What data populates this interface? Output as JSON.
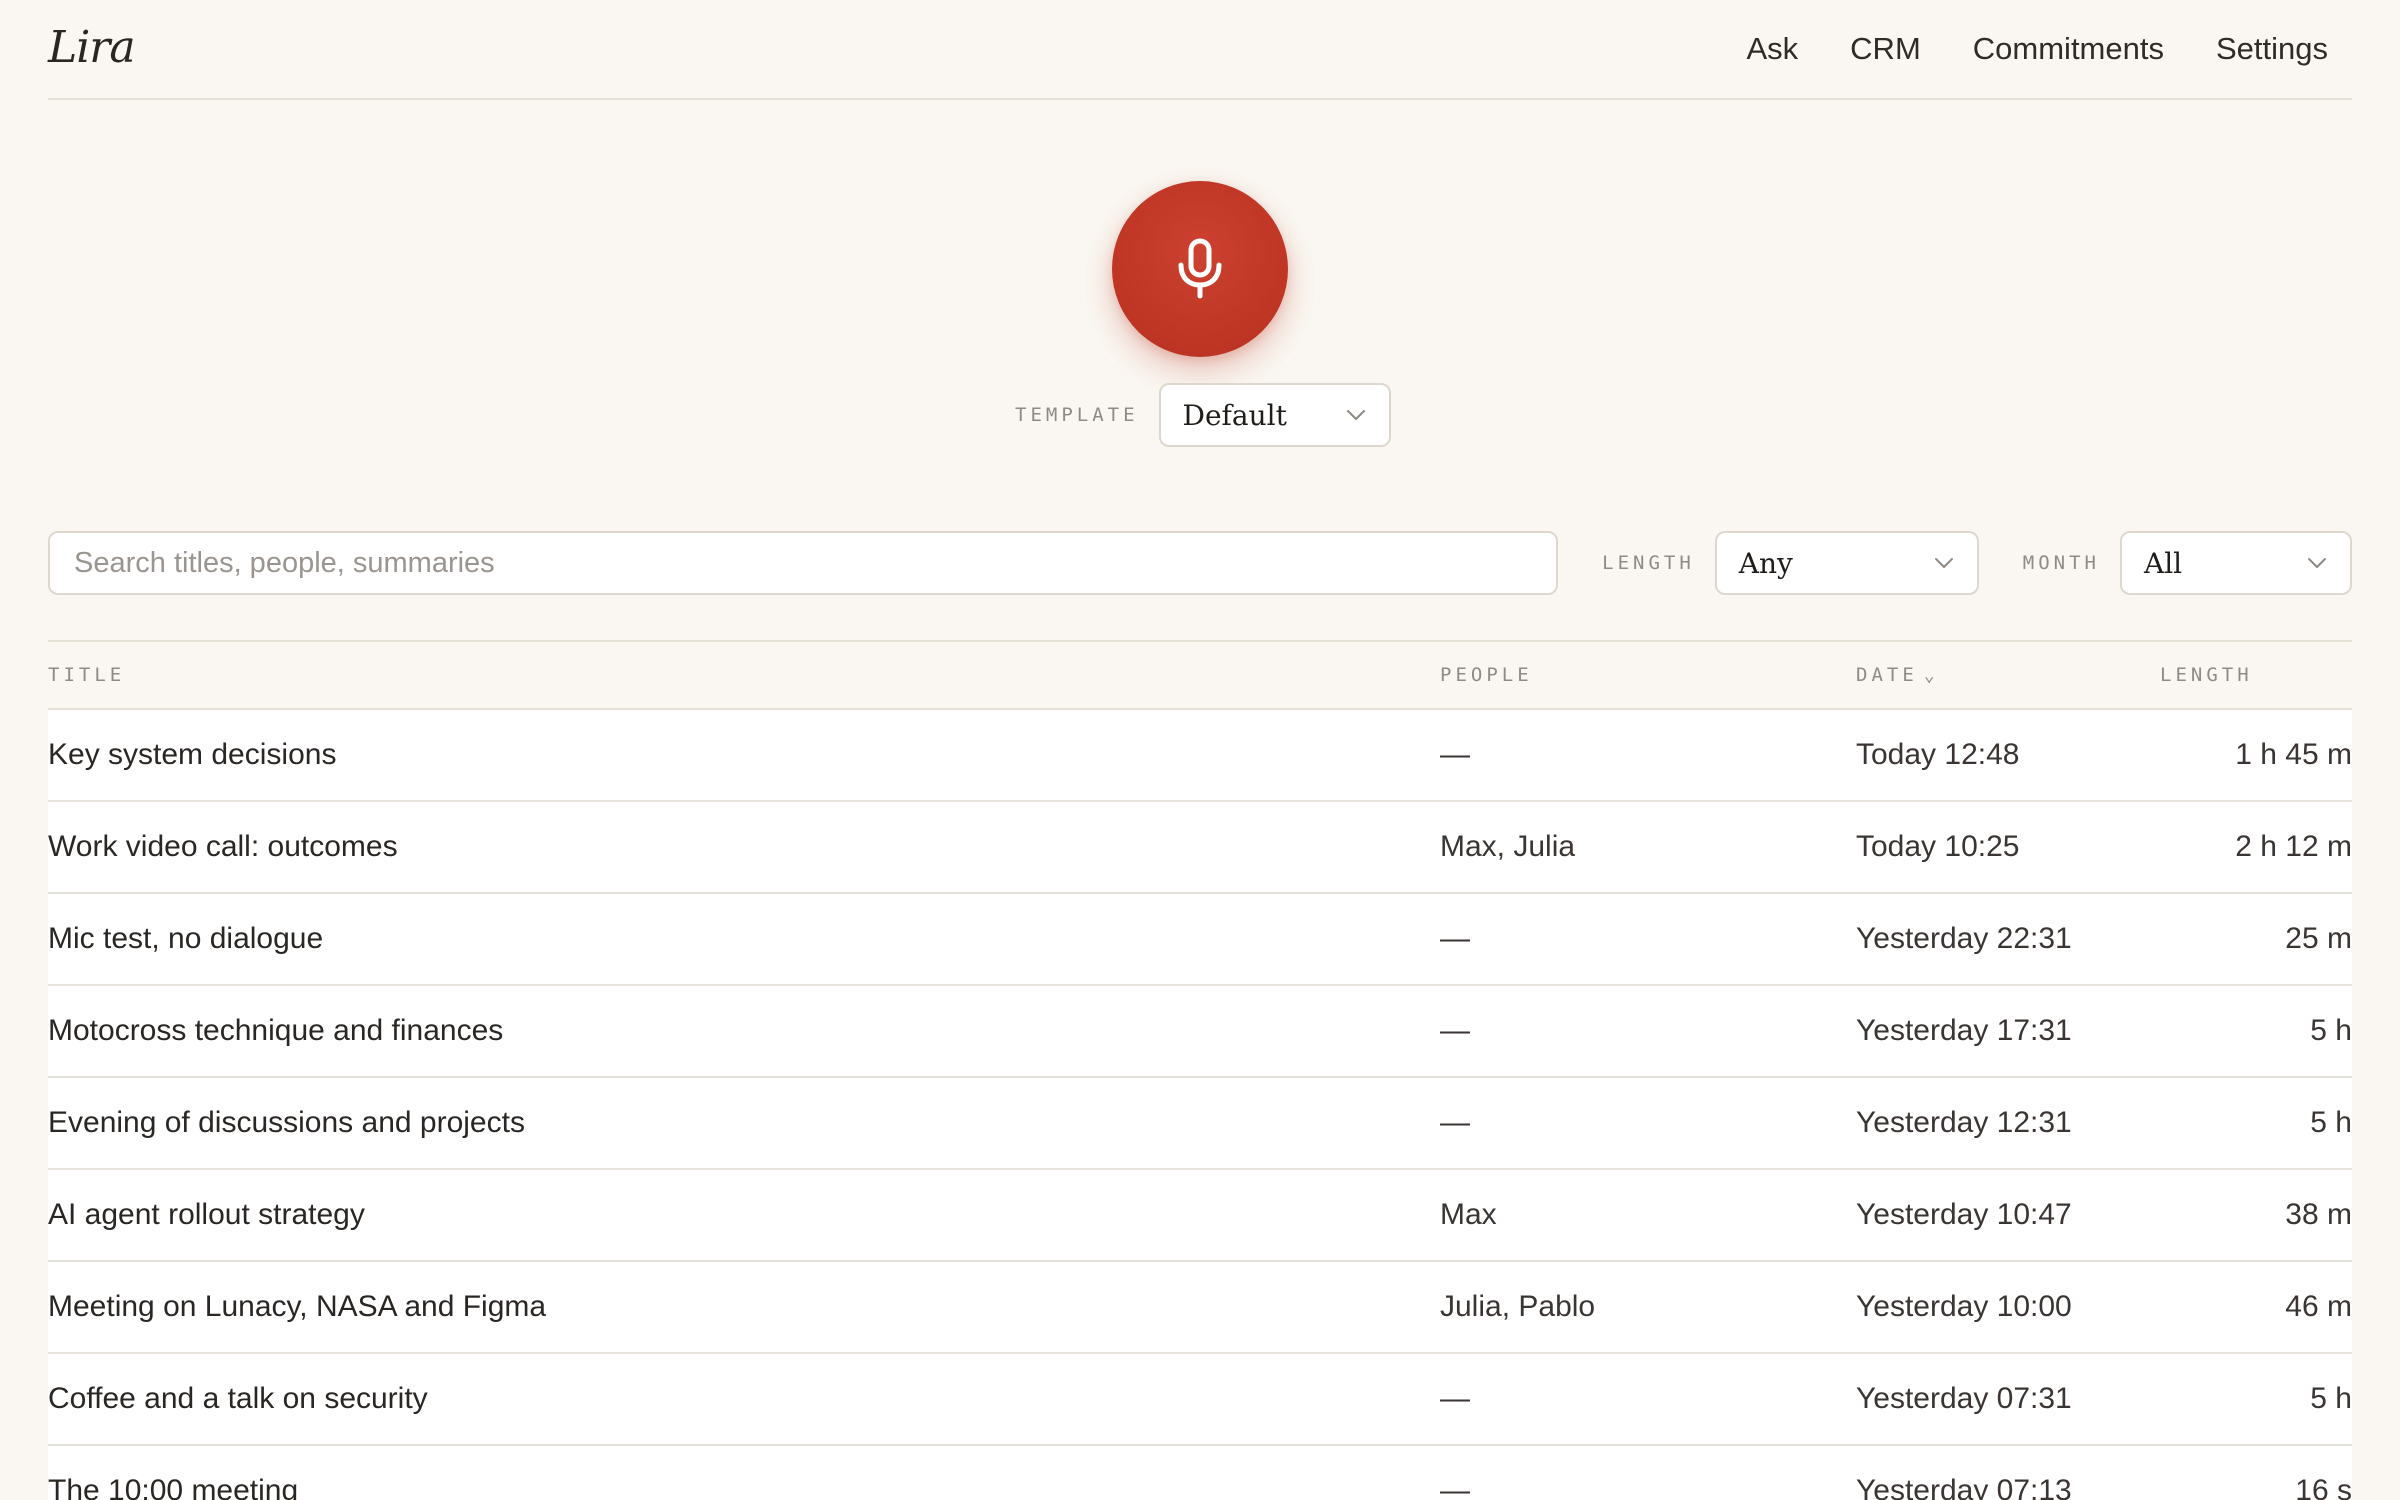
{
  "app": {
    "logo": "Lira"
  },
  "nav": {
    "ask": "Ask",
    "crm": "CRM",
    "commitments": "Commitments",
    "settings": "Settings"
  },
  "record": {
    "icon": "microphone-icon",
    "color": "#c23a28"
  },
  "template": {
    "label": "TEMPLATE",
    "value": "Default"
  },
  "filters": {
    "search_placeholder": "Search titles, people, summaries",
    "search_value": "",
    "length_label": "LENGTH",
    "length_value": "Any",
    "month_label": "MONTH",
    "month_value": "All"
  },
  "table": {
    "headers": {
      "title": "TITLE",
      "people": "PEOPLE",
      "date": "DATE",
      "date_sort": "⌄",
      "length": "LENGTH"
    },
    "rows": [
      {
        "title": "Key system decisions",
        "people": "—",
        "date": "Today 12:48",
        "length": "1 h 45 m"
      },
      {
        "title": "Work video call: outcomes",
        "people": "Max, Julia",
        "date": "Today 10:25",
        "length": "2 h 12 m"
      },
      {
        "title": "Mic test, no dialogue",
        "people": "—",
        "date": "Yesterday 22:31",
        "length": "25 m"
      },
      {
        "title": "Motocross technique and finances",
        "people": "—",
        "date": "Yesterday 17:31",
        "length": "5 h"
      },
      {
        "title": "Evening of discussions and projects",
        "people": "—",
        "date": "Yesterday 12:31",
        "length": "5 h"
      },
      {
        "title": "AI agent rollout strategy",
        "people": "Max",
        "date": "Yesterday 10:47",
        "length": "38 m"
      },
      {
        "title": "Meeting on Lunacy, NASA and Figma",
        "people": "Julia, Pablo",
        "date": "Yesterday 10:00",
        "length": "46 m"
      },
      {
        "title": "Coffee and a talk on security",
        "people": "—",
        "date": "Yesterday 07:31",
        "length": "5 h"
      },
      {
        "title": "The 10:00 meeting",
        "people": "—",
        "date": "Yesterday 07:13",
        "length": "16 s"
      }
    ]
  }
}
